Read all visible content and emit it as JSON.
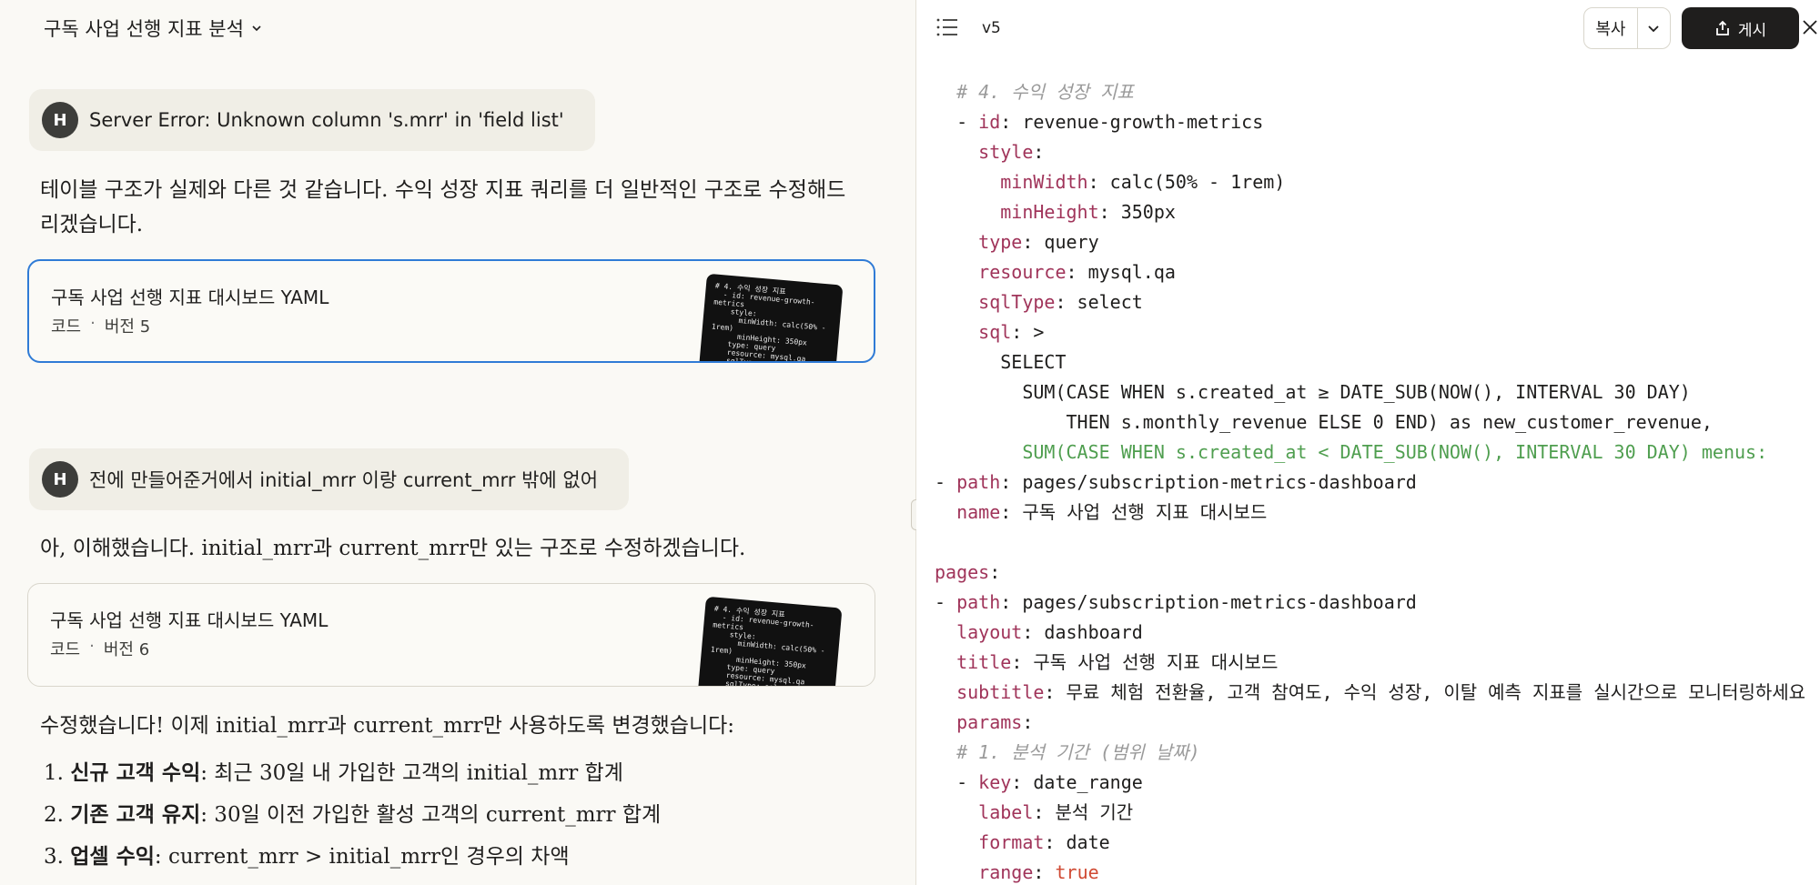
{
  "conversation": {
    "title": "구독 사업 선행 지표 분석"
  },
  "messages": {
    "user1": {
      "avatar": "H",
      "text": "Server Error: Unknown column 's.mrr' in 'field list'"
    },
    "assistant1": {
      "text": "테이블 구조가 실제와 다른 것 같습니다. 수익 성장 지표 쿼리를 더 일반적인 구조로 수정해드리겠습니다."
    },
    "artifact1": {
      "title": "구독 사업 선행 지표 대시보드 YAML",
      "type": "코드",
      "separator": "·",
      "version": "버전 5"
    },
    "user2": {
      "avatar": "H",
      "text": "전에 만들어준거에서 initial_mrr 이랑 current_mrr 밖에 없어"
    },
    "assistant2": {
      "text": "아, 이해했습니다. initial_mrr과 current_mrr만 있는 구조로 수정하겠습니다."
    },
    "artifact2": {
      "title": "구독 사업 선행 지표 대시보드 YAML",
      "type": "코드",
      "separator": "·",
      "version": "버전 6"
    },
    "assistant3": {
      "intro": "수정했습니다! 이제 initial_mrr과 current_mrr만 사용하도록 변경했습니다:",
      "items": [
        {
          "num": "1.",
          "bold": "신규 고객 수익",
          "rest": ": 최근 30일 내 가입한 고객의 initial_mrr 합계"
        },
        {
          "num": "2.",
          "bold": "기존 고객 유지",
          "rest": ": 30일 이전 가입한 활성 고객의 current_mrr 합계"
        },
        {
          "num": "3.",
          "bold": "업셀 수익",
          "rest": ": current_mrr > initial_mrr인 경우의 차액"
        }
      ]
    }
  },
  "thumbnail": {
    "text": "# 4. 수익 성장 지표\n  - id: revenue-growth-\nmetrics\n    style:\n      minWidth: calc(50% -\n1rem)\n      minHeight: 350px\n    type: query\n    resource: mysql.qa\n    sqlType: select"
  },
  "panel": {
    "version": "v5",
    "copy_label": "복사",
    "publish_label": "게시"
  },
  "code": {
    "lines": [
      [
        {
          "c": "cm",
          "t": "  # 4. 수익 성장 지표"
        }
      ],
      [
        {
          "c": "",
          "t": "  - "
        },
        {
          "c": "k",
          "t": "id"
        },
        {
          "c": "",
          "t": ": revenue-growth-metrics"
        }
      ],
      [
        {
          "c": "",
          "t": "    "
        },
        {
          "c": "k",
          "t": "style"
        },
        {
          "c": "",
          "t": ":"
        }
      ],
      [
        {
          "c": "",
          "t": "      "
        },
        {
          "c": "k",
          "t": "minWidth"
        },
        {
          "c": "",
          "t": ": calc(50% - 1rem)"
        }
      ],
      [
        {
          "c": "",
          "t": "      "
        },
        {
          "c": "k",
          "t": "minHeight"
        },
        {
          "c": "",
          "t": ": 350px"
        }
      ],
      [
        {
          "c": "",
          "t": "    "
        },
        {
          "c": "k",
          "t": "type"
        },
        {
          "c": "",
          "t": ": query"
        }
      ],
      [
        {
          "c": "",
          "t": "    "
        },
        {
          "c": "k",
          "t": "resource"
        },
        {
          "c": "",
          "t": ": mysql.qa"
        }
      ],
      [
        {
          "c": "",
          "t": "    "
        },
        {
          "c": "k",
          "t": "sqlType"
        },
        {
          "c": "",
          "t": ": select"
        }
      ],
      [
        {
          "c": "",
          "t": "    "
        },
        {
          "c": "k",
          "t": "sql"
        },
        {
          "c": "",
          "t": ": >"
        }
      ],
      [
        {
          "c": "",
          "t": "      SELECT"
        }
      ],
      [
        {
          "c": "",
          "t": "        SUM(CASE WHEN s.created_at ≥ DATE_SUB(NOW(), INTERVAL 30 DAY)"
        }
      ],
      [
        {
          "c": "",
          "t": "            THEN s.monthly_revenue ELSE 0 END) as new_customer_revenue,"
        }
      ],
      [
        {
          "c": "g",
          "t": "        SUM(CASE WHEN s.created_at < DATE_SUB(NOW(), INTERVAL 30 DAY) menus:"
        }
      ],
      [
        {
          "c": "",
          "t": "- "
        },
        {
          "c": "k",
          "t": "path"
        },
        {
          "c": "",
          "t": ": pages/subscription-metrics-dashboard"
        }
      ],
      [
        {
          "c": "",
          "t": "  "
        },
        {
          "c": "k",
          "t": "name"
        },
        {
          "c": "",
          "t": ": 구독 사업 선행 지표 대시보드"
        }
      ],
      [
        {
          "c": "",
          "t": ""
        }
      ],
      [
        {
          "c": "k",
          "t": "pages"
        },
        {
          "c": "",
          "t": ":"
        }
      ],
      [
        {
          "c": "",
          "t": "- "
        },
        {
          "c": "k",
          "t": "path"
        },
        {
          "c": "",
          "t": ": pages/subscription-metrics-dashboard"
        }
      ],
      [
        {
          "c": "",
          "t": "  "
        },
        {
          "c": "k",
          "t": "layout"
        },
        {
          "c": "",
          "t": ": dashboard"
        }
      ],
      [
        {
          "c": "",
          "t": "  "
        },
        {
          "c": "k",
          "t": "title"
        },
        {
          "c": "",
          "t": ": 구독 사업 선행 지표 대시보드"
        }
      ],
      [
        {
          "c": "",
          "t": "  "
        },
        {
          "c": "k",
          "t": "subtitle"
        },
        {
          "c": "",
          "t": ": 무료 체험 전환율, 고객 참여도, 수익 성장, 이탈 예측 지표를 실시간으로 모니터링하세요"
        }
      ],
      [
        {
          "c": "",
          "t": "  "
        },
        {
          "c": "k",
          "t": "params"
        },
        {
          "c": "",
          "t": ":"
        }
      ],
      [
        {
          "c": "cm",
          "t": "  # 1. 분석 기간 (범위 날짜)"
        }
      ],
      [
        {
          "c": "",
          "t": "  - "
        },
        {
          "c": "k",
          "t": "key"
        },
        {
          "c": "",
          "t": ": date_range"
        }
      ],
      [
        {
          "c": "",
          "t": "    "
        },
        {
          "c": "k",
          "t": "label"
        },
        {
          "c": "",
          "t": ": 분석 기간"
        }
      ],
      [
        {
          "c": "",
          "t": "    "
        },
        {
          "c": "k",
          "t": "format"
        },
        {
          "c": "",
          "t": ": date"
        }
      ],
      [
        {
          "c": "",
          "t": "    "
        },
        {
          "c": "k",
          "t": "range"
        },
        {
          "c": "",
          "t": ": "
        },
        {
          "c": "t",
          "t": "true"
        }
      ]
    ]
  },
  "colors": {
    "key": "#a0345a",
    "comment": "#9a9a9a",
    "bool": "#d04a33",
    "green": "#4f9e4f",
    "accent_border": "#2f7bd6"
  }
}
